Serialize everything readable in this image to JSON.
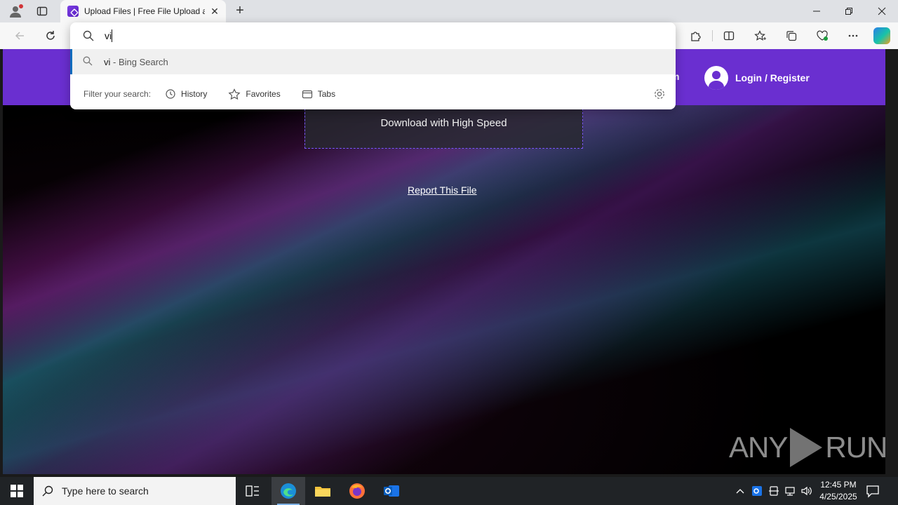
{
  "browser": {
    "tab": {
      "title": "Upload Files | Free File Upload and"
    },
    "omnibox": {
      "query": "vi",
      "suggestion_query": "vi",
      "suggestion_suffix": " - Bing Search",
      "filter_label": "Filter your search:",
      "filters": [
        "History",
        "Favorites",
        "Tabs"
      ]
    }
  },
  "page": {
    "header_peek": "m",
    "login_label": "Login / Register",
    "download_label": "Download with High Speed",
    "report_label": "Report This File",
    "watermark_left": "ANY",
    "watermark_right": "RUN"
  },
  "taskbar": {
    "search_placeholder": "Type here to search",
    "time": "12:45 PM",
    "date": "4/25/2025"
  },
  "colors": {
    "header_purple": "#6a2fd0",
    "accent_blue": "#0f6cbd"
  }
}
